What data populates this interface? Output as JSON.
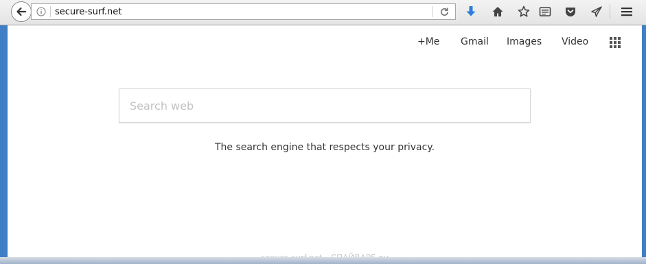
{
  "browser": {
    "url": "secure-surf.net",
    "toolbar_icons": [
      "download-icon",
      "home-icon",
      "bookmark-star-icon",
      "reading-list-icon",
      "pocket-icon",
      "send-tab-icon",
      "menu-icon"
    ],
    "accent_download": "#2a7fd9"
  },
  "page": {
    "nav": {
      "me": "+Me",
      "gmail": "Gmail",
      "images": "Images",
      "video": "Video"
    },
    "search": {
      "placeholder": "Search web",
      "value": ""
    },
    "tagline": "The search engine that respects your privacy.",
    "watermark": "secure-surf.net - СПАЙВАРЕ.ру"
  }
}
